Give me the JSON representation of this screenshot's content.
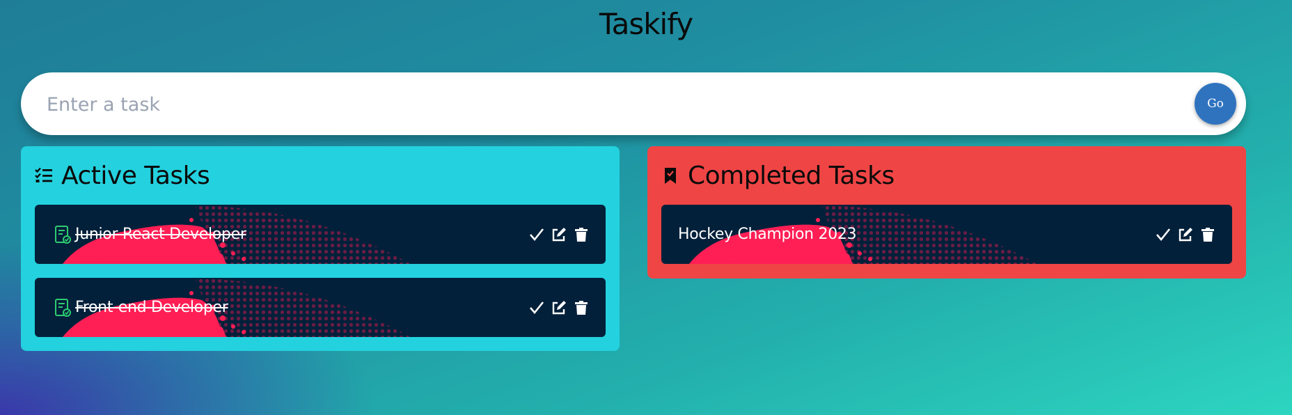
{
  "app": {
    "title": "Taskify"
  },
  "form": {
    "placeholder": "Enter a task",
    "submit_label": "Go"
  },
  "active_panel": {
    "heading": "Active Tasks",
    "icon": "checklist-icon",
    "tasks": [
      {
        "text": "Junior React Developer",
        "done": true
      },
      {
        "text": "Front-end Developer",
        "done": true
      }
    ]
  },
  "completed_panel": {
    "heading": "Completed Tasks",
    "icon": "bookmark-icon",
    "tasks": [
      {
        "text": "Hockey Champion 2023",
        "done": false
      }
    ]
  },
  "task_actions": [
    "check-icon",
    "edit-icon",
    "delete-icon"
  ],
  "colors": {
    "active_panel": "#24d1de",
    "completed_panel": "#ef4545",
    "card": "#03203a",
    "splash": "#ff1f55",
    "go_button": "#2f73bf",
    "doc_icon": "#2ecc71"
  }
}
